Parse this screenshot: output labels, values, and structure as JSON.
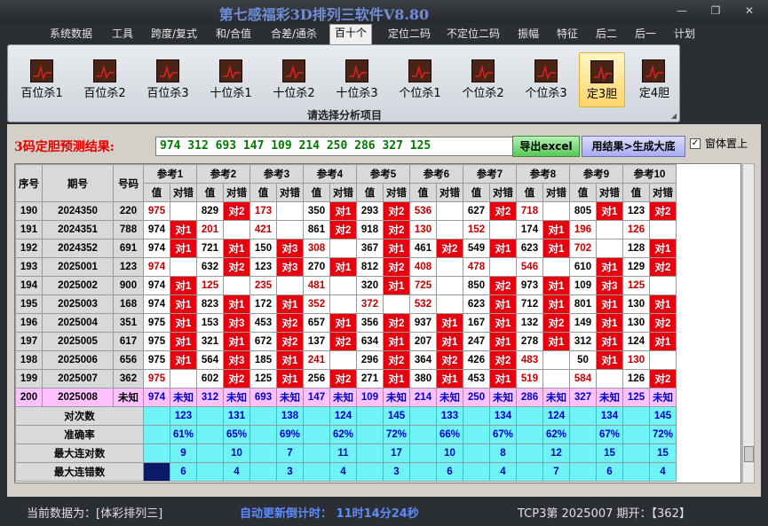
{
  "window": {
    "title": "第七感福彩3D排列三软件V8.80"
  },
  "menu": [
    "系统数据",
    "工具",
    "跨度/复式",
    "和/合值",
    "合差/通杀",
    "百十个",
    "定位二码",
    "不定位二码",
    "振幅",
    "特征",
    "后二",
    "后一",
    "计划"
  ],
  "menu_active_index": 5,
  "toolbar": {
    "buttons": [
      "百位杀1",
      "百位杀2",
      "百位杀3",
      "十位杀1",
      "十位杀2",
      "十位杀3",
      "个位杀1",
      "个位杀2",
      "个位杀3",
      "定3胆",
      "定4胆"
    ],
    "selected_index": 9,
    "caption": "请选择分析项目"
  },
  "prediction": {
    "label": "3码定胆预测结果:",
    "value": "974 312 693 147 109 214 250 286 327 125",
    "export_button": "导出excel",
    "generate_button": "用结果>生成大底",
    "pin_checkbox_label": "窗体置上",
    "pin_checked": true
  },
  "grid": {
    "head_seq": "序号",
    "head_period": "期号",
    "head_num": "号码",
    "ref_groups": [
      "参考1",
      "参考2",
      "参考3",
      "参考4",
      "参考5",
      "参考6",
      "参考7",
      "参考8",
      "参考9",
      "参考10"
    ],
    "sub_value": "值",
    "sub_check": "对错",
    "rows": [
      {
        "seq": "190",
        "period": "2024350",
        "num": "220",
        "cells": [
          [
            "975",
            "r",
            ""
          ],
          [
            "829",
            "k",
            "对2"
          ],
          [
            "173",
            "r",
            ""
          ],
          [
            "350",
            "k",
            "对1"
          ],
          [
            "293",
            "k",
            "对2"
          ],
          [
            "536",
            "r",
            ""
          ],
          [
            "627",
            "k",
            "对2"
          ],
          [
            "718",
            "r",
            ""
          ],
          [
            "805",
            "k",
            "对1"
          ],
          [
            "123",
            "k",
            "对2"
          ]
        ]
      },
      {
        "seq": "191",
        "period": "2024351",
        "num": "788",
        "cells": [
          [
            "974",
            "k",
            "对1"
          ],
          [
            "201",
            "r",
            ""
          ],
          [
            "421",
            "r",
            ""
          ],
          [
            "861",
            "k",
            "对2"
          ],
          [
            "918",
            "k",
            "对2"
          ],
          [
            "130",
            "r",
            ""
          ],
          [
            "152",
            "r",
            ""
          ],
          [
            "174",
            "k",
            "对1"
          ],
          [
            "196",
            "r",
            ""
          ],
          [
            "126",
            "r",
            ""
          ]
        ]
      },
      {
        "seq": "192",
        "period": "2024352",
        "num": "691",
        "cells": [
          [
            "974",
            "k",
            "对1"
          ],
          [
            "721",
            "k",
            "对1"
          ],
          [
            "150",
            "k",
            "对3"
          ],
          [
            "308",
            "r",
            ""
          ],
          [
            "367",
            "k",
            "对1"
          ],
          [
            "461",
            "k",
            "对2"
          ],
          [
            "549",
            "k",
            "对1"
          ],
          [
            "623",
            "k",
            "对1"
          ],
          [
            "702",
            "r",
            ""
          ],
          [
            "128",
            "k",
            "对1"
          ]
        ]
      },
      {
        "seq": "193",
        "period": "2025001",
        "num": "123",
        "cells": [
          [
            "974",
            "r",
            ""
          ],
          [
            "632",
            "k",
            "对2"
          ],
          [
            "123",
            "k",
            "对3"
          ],
          [
            "270",
            "k",
            "对1"
          ],
          [
            "812",
            "k",
            "对2"
          ],
          [
            "408",
            "r",
            ""
          ],
          [
            "478",
            "r",
            ""
          ],
          [
            "546",
            "r",
            ""
          ],
          [
            "610",
            "k",
            "对1"
          ],
          [
            "129",
            "k",
            "对2"
          ]
        ]
      },
      {
        "seq": "194",
        "period": "2025002",
        "num": "900",
        "cells": [
          [
            "974",
            "k",
            "对1"
          ],
          [
            "125",
            "r",
            ""
          ],
          [
            "235",
            "r",
            ""
          ],
          [
            "481",
            "r",
            ""
          ],
          [
            "320",
            "k",
            "对1"
          ],
          [
            "725",
            "r",
            ""
          ],
          [
            "850",
            "k",
            "对2"
          ],
          [
            "973",
            "k",
            "对1"
          ],
          [
            "109",
            "k",
            "对3"
          ],
          [
            "125",
            "r",
            ""
          ]
        ]
      },
      {
        "seq": "195",
        "period": "2025003",
        "num": "168",
        "cells": [
          [
            "974",
            "k",
            "对1"
          ],
          [
            "823",
            "k",
            "对1"
          ],
          [
            "172",
            "k",
            "对1"
          ],
          [
            "352",
            "r",
            ""
          ],
          [
            "372",
            "r",
            ""
          ],
          [
            "532",
            "r",
            ""
          ],
          [
            "623",
            "k",
            "对1"
          ],
          [
            "712",
            "k",
            "对1"
          ],
          [
            "801",
            "k",
            "对1"
          ],
          [
            "130",
            "k",
            "对1"
          ]
        ]
      },
      {
        "seq": "196",
        "period": "2025004",
        "num": "351",
        "cells": [
          [
            "975",
            "k",
            "对1"
          ],
          [
            "153",
            "k",
            "对3"
          ],
          [
            "453",
            "k",
            "对2"
          ],
          [
            "657",
            "k",
            "对1"
          ],
          [
            "356",
            "k",
            "对2"
          ],
          [
            "937",
            "k",
            "对1"
          ],
          [
            "167",
            "k",
            "对1"
          ],
          [
            "132",
            "k",
            "对2"
          ],
          [
            "149",
            "k",
            "对1"
          ],
          [
            "130",
            "k",
            "对2"
          ]
        ]
      },
      {
        "seq": "197",
        "period": "2025005",
        "num": "617",
        "cells": [
          [
            "975",
            "k",
            "对1"
          ],
          [
            "321",
            "k",
            "对1"
          ],
          [
            "672",
            "k",
            "对2"
          ],
          [
            "137",
            "k",
            "对2"
          ],
          [
            "634",
            "k",
            "对1"
          ],
          [
            "207",
            "k",
            "对1"
          ],
          [
            "247",
            "k",
            "对1"
          ],
          [
            "278",
            "k",
            "对1"
          ],
          [
            "312",
            "k",
            "对1"
          ],
          [
            "124",
            "k",
            "对1"
          ]
        ]
      },
      {
        "seq": "198",
        "period": "2025006",
        "num": "656",
        "cells": [
          [
            "975",
            "k",
            "对1"
          ],
          [
            "564",
            "k",
            "对3"
          ],
          [
            "185",
            "k",
            "对1"
          ],
          [
            "241",
            "r",
            ""
          ],
          [
            "296",
            "k",
            "对2"
          ],
          [
            "364",
            "k",
            "对2"
          ],
          [
            "426",
            "k",
            "对2"
          ],
          [
            "483",
            "r",
            ""
          ],
          [
            "50",
            "k",
            "对1"
          ],
          [
            "130",
            "r",
            ""
          ]
        ]
      },
      {
        "seq": "199",
        "period": "2025007",
        "num": "362",
        "cells": [
          [
            "975",
            "r",
            ""
          ],
          [
            "602",
            "k",
            "对2"
          ],
          [
            "125",
            "k",
            "对1"
          ],
          [
            "256",
            "k",
            "对2"
          ],
          [
            "271",
            "k",
            "对1"
          ],
          [
            "380",
            "k",
            "对1"
          ],
          [
            "453",
            "k",
            "对1"
          ],
          [
            "519",
            "r",
            ""
          ],
          [
            "584",
            "r",
            ""
          ],
          [
            "126",
            "k",
            "对2"
          ]
        ]
      }
    ],
    "last_row": {
      "seq": "200",
      "period": "2025008",
      "num": "未知",
      "values": [
        "974",
        "312",
        "693",
        "147",
        "109",
        "214",
        "250",
        "286",
        "327",
        "125"
      ],
      "status": "未知"
    },
    "stats": [
      {
        "label": "对次数",
        "values": [
          "123",
          "131",
          "138",
          "124",
          "145",
          "133",
          "134",
          "124",
          "134",
          "145"
        ]
      },
      {
        "label": "准确率",
        "values": [
          "61%",
          "65%",
          "69%",
          "62%",
          "72%",
          "66%",
          "67%",
          "62%",
          "67%",
          "72%"
        ]
      },
      {
        "label": "最大连对数",
        "values": [
          "9",
          "10",
          "7",
          "11",
          "17",
          "10",
          "8",
          "12",
          "15",
          "15"
        ]
      },
      {
        "label": "最大连错数",
        "values": [
          "6",
          "4",
          "3",
          "4",
          "3",
          "6",
          "4",
          "7",
          "6",
          "4"
        ]
      }
    ]
  },
  "status": {
    "current_data": "当前数据为：[体彩排列三]",
    "countdown": "自动更新倒计时： 11时14分24秒",
    "draw_info": "TCP3第 2025007 期开：【362】"
  },
  "colors": {
    "hit_red": "#e8000e",
    "miss_text": "#c00000",
    "stats_cyan": "#6ff3f7",
    "last_row_pink": "#ffc2ff",
    "title_blue": "#6f8dd8"
  }
}
